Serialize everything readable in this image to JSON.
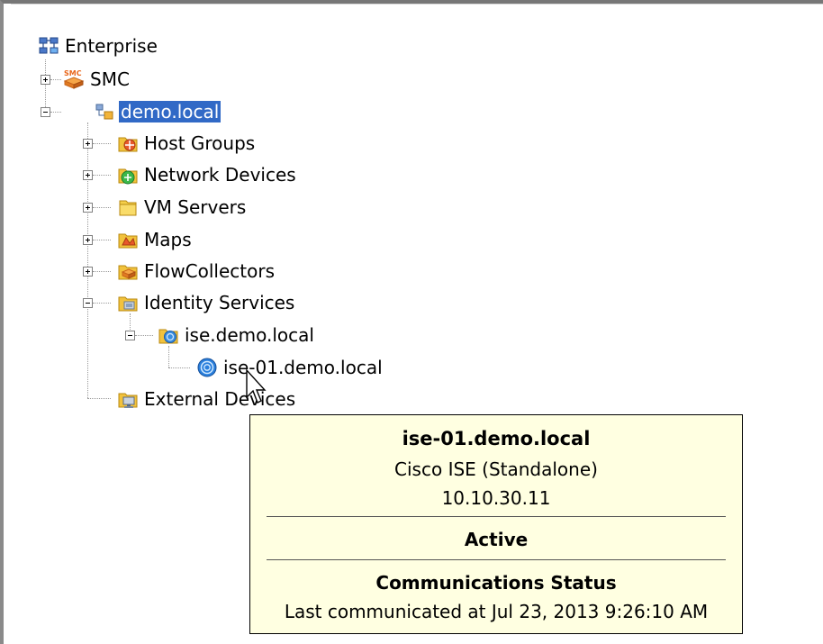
{
  "tree": {
    "root": {
      "label": "Enterprise",
      "icon": "enterprise-icon"
    },
    "smc": {
      "label": "SMC",
      "icon": "smc-icon"
    },
    "domain": {
      "label": "demo.local",
      "icon": "domain-icon",
      "selected": true
    },
    "children": [
      {
        "label": "Host Groups",
        "icon": "host-groups-icon"
      },
      {
        "label": "Network Devices",
        "icon": "network-devices-icon"
      },
      {
        "label": "VM Servers",
        "icon": "vm-servers-icon"
      },
      {
        "label": "Maps",
        "icon": "maps-icon"
      },
      {
        "label": "FlowCollectors",
        "icon": "flowcollectors-icon"
      },
      {
        "label": "Identity Services",
        "icon": "identity-services-icon"
      }
    ],
    "ise_parent": {
      "label": "ise.demo.local",
      "icon": "ise-folder-icon"
    },
    "ise_node": {
      "label": "ise-01.demo.local",
      "icon": "ise-node-icon"
    },
    "external": {
      "label": "External Devices",
      "icon": "external-devices-icon"
    }
  },
  "tooltip": {
    "title": "ise-01.demo.local",
    "device_type": "Cisco ISE (Standalone)",
    "ip": "10.10.30.11",
    "state": "Active",
    "comm_heading": "Communications Status",
    "comm_detail": "Last communicated at Jul 23, 2013 9:26:10 AM"
  },
  "colors": {
    "selection": "#3169c6",
    "tooltip_bg": "#ffffe1",
    "folder": "#f2c23c",
    "smc": "#f08a24"
  }
}
